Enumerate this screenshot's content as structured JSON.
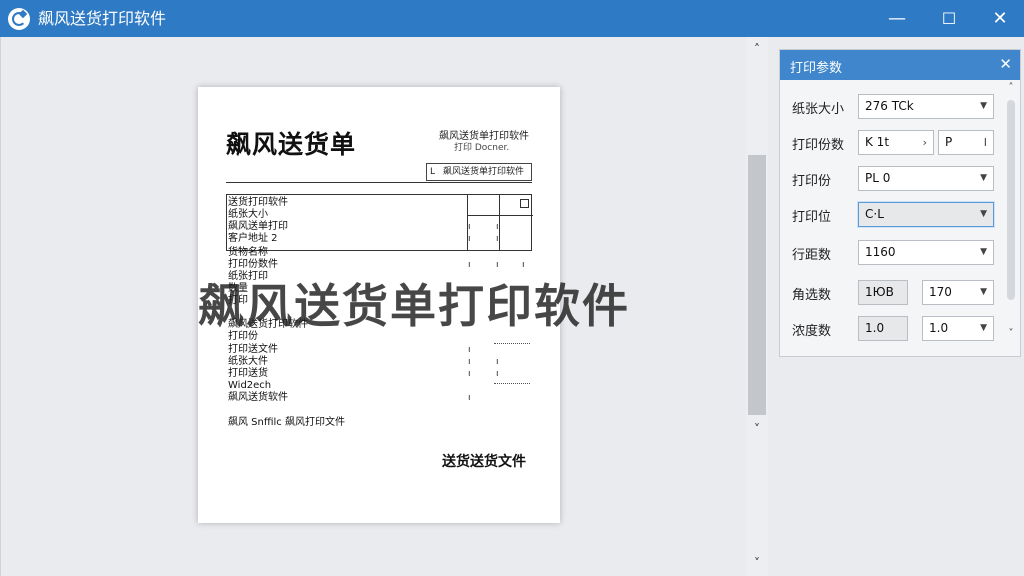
{
  "window": {
    "title": "飙风送货打印软件",
    "minimize": "—",
    "maximize": "☐",
    "close": "✕"
  },
  "document": {
    "title": "飙风送货单",
    "header_right": "飙风送货单打印软件",
    "header_sub": "打印 Docner.",
    "box_label": "飙风送货单打印软件",
    "rows": [
      "送货打印软件",
      "纸张大小",
      "飙风送单打印",
      "客户地址 2",
      "货物名称",
      "打印份数件",
      "纸张打印",
      "数量",
      "打印",
      "飙风送货打印软件",
      "打印份",
      "打印送文件",
      "纸张大件",
      "打印送货",
      "Wid2ech",
      "飙风送货软件"
    ],
    "footer_note": "飙风 Snffilc 飙风打印文件",
    "footer": "送货送货文件"
  },
  "watermark": "飙风送货单打印软件",
  "panel": {
    "title": "打印参数",
    "close": "✕",
    "rows": [
      {
        "label": "纸张大小",
        "value": "276 TCk"
      },
      {
        "label": "打印份数",
        "value_a": "K  1t",
        "value_b": "P",
        "value_c": "Ⅰ"
      },
      {
        "label": "打印份",
        "value": "PL  0"
      },
      {
        "label": "打印位",
        "value": "C·L"
      },
      {
        "label": "行距数",
        "value": "1160"
      },
      {
        "label": "角选数",
        "value_a": "1ЮB",
        "value_b": "170"
      },
      {
        "label": "浓度数",
        "value_a": "1.0",
        "value_b": "1.0"
      }
    ]
  },
  "scroll": {
    "up": "˄",
    "down": "˅"
  }
}
